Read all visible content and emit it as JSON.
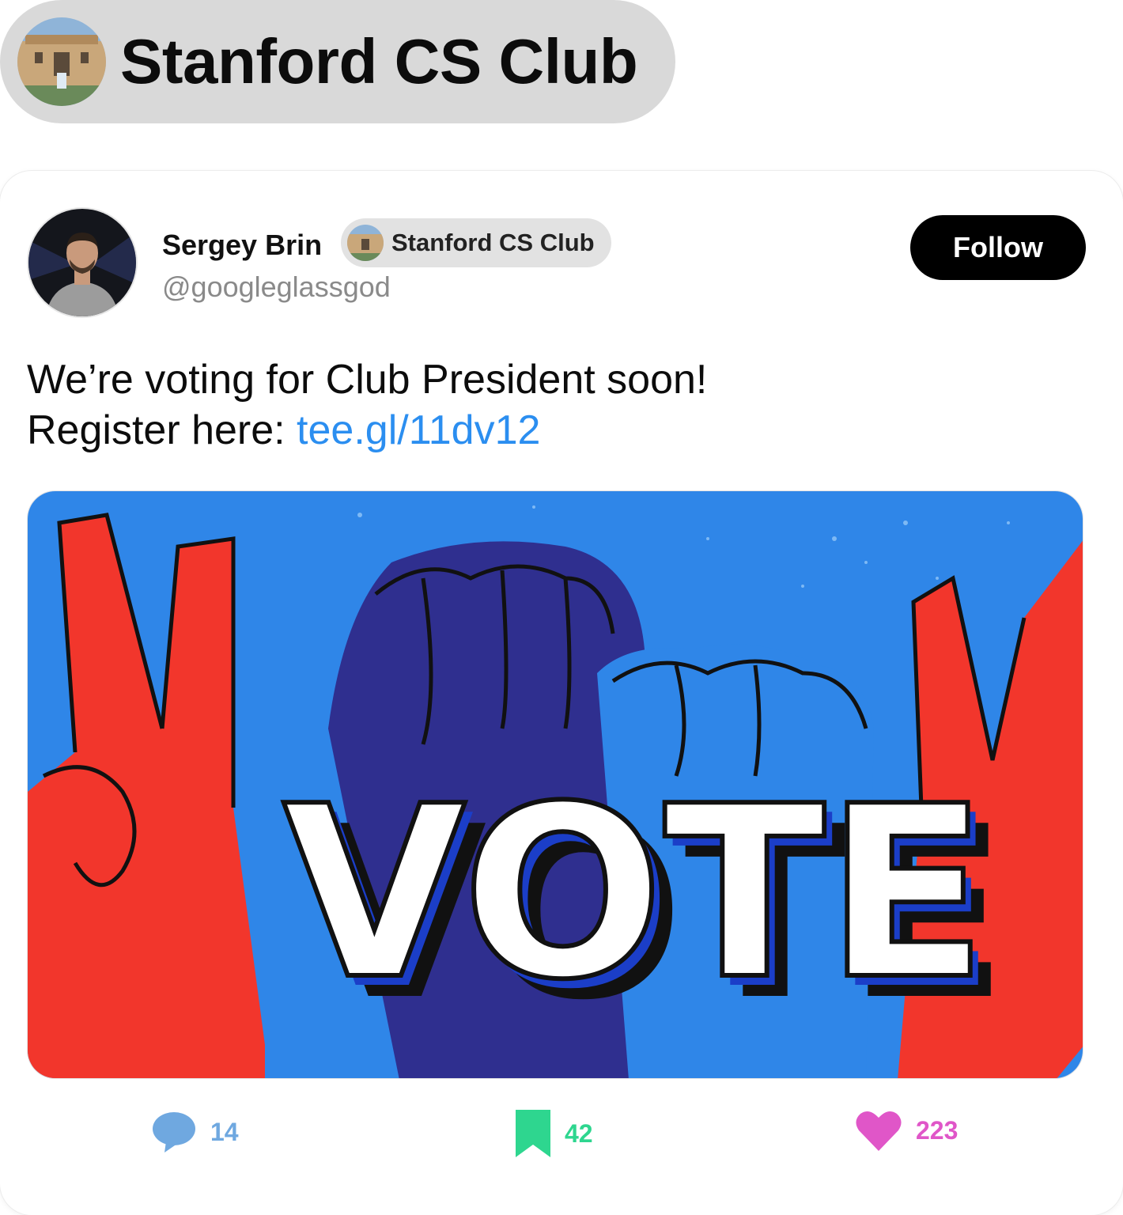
{
  "club_header": {
    "name": "Stanford CS Club"
  },
  "post": {
    "author": {
      "name": "Sergey Brin",
      "handle": "@googleglassgod",
      "club_chip": "Stanford CS Club"
    },
    "follow_label": "Follow",
    "text_line1": "We’re voting for Club President soon!",
    "text_line2_prefix": "Register here: ",
    "link_text": "tee.gl/11dv12",
    "image": {
      "text": "VOTE",
      "background_color": "#2f86e8"
    },
    "actions": {
      "comments": {
        "count": "14",
        "icon": "comment-bubble-icon",
        "color": "#6fa8e0"
      },
      "bookmarks": {
        "count": "42",
        "icon": "bookmark-icon",
        "color": "#2ed68f"
      },
      "likes": {
        "count": "223",
        "icon": "heart-icon",
        "color": "#e056c8"
      }
    }
  }
}
